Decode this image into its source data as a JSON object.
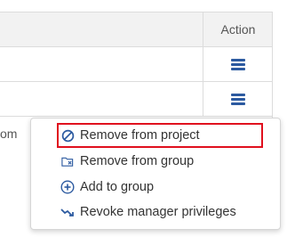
{
  "table": {
    "action_header": "Action",
    "rows": [
      {
        "text": ""
      },
      {
        "text": ""
      },
      {
        "text": "om"
      }
    ]
  },
  "menu": {
    "items": [
      {
        "label": "Remove from project",
        "icon": "ban-icon",
        "highlighted": true
      },
      {
        "label": "Remove from group",
        "icon": "folder-remove-icon",
        "highlighted": false
      },
      {
        "label": "Add to group",
        "icon": "plus-circle-icon",
        "highlighted": false
      },
      {
        "label": "Revoke manager privileges",
        "icon": "trend-down-icon",
        "highlighted": false
      }
    ]
  },
  "colors": {
    "accent": "#2c5aa0",
    "highlight_border": "#e0101e"
  }
}
